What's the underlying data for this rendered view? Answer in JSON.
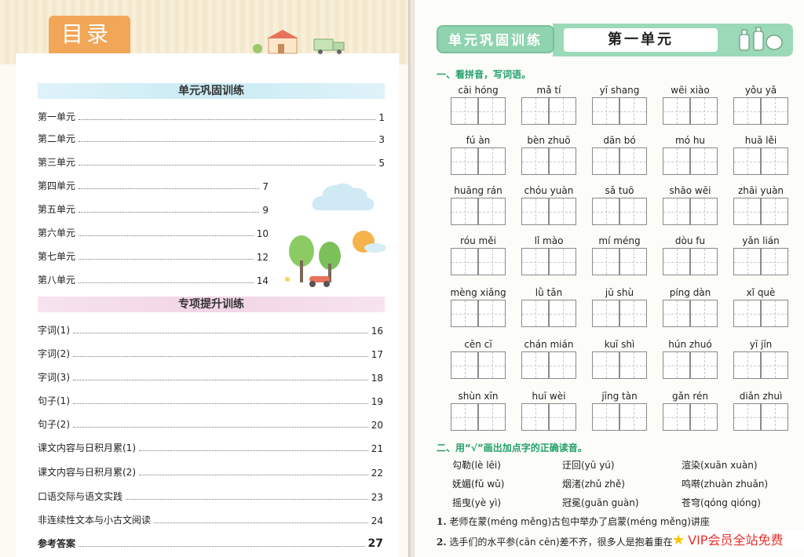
{
  "toc": {
    "tab_title": "目录",
    "section1": {
      "title": "单元巩固训练",
      "items": [
        {
          "label": "第一单元",
          "page": "1"
        },
        {
          "label": "第二单元",
          "page": "3"
        },
        {
          "label": "第三单元",
          "page": "5"
        },
        {
          "label": "第四单元",
          "page": "7"
        },
        {
          "label": "第五单元",
          "page": "9"
        },
        {
          "label": "第六单元",
          "page": "10"
        },
        {
          "label": "第七单元",
          "page": "12"
        },
        {
          "label": "第八单元",
          "page": "14"
        }
      ]
    },
    "section2": {
      "title": "专项提升训练",
      "items": [
        {
          "label": "字词(1)",
          "page": "16"
        },
        {
          "label": "字词(2)",
          "page": "17"
        },
        {
          "label": "字词(3)",
          "page": "18"
        },
        {
          "label": "句子(1)",
          "page": "19"
        },
        {
          "label": "句子(2)",
          "page": "20"
        },
        {
          "label": "课文内容与日积月累(1)",
          "page": "21"
        },
        {
          "label": "课文内容与日积月累(2)",
          "page": "22"
        },
        {
          "label": "口语交际与语文实践",
          "page": "23"
        },
        {
          "label": "非连续性文本与小古文阅读",
          "page": "24"
        }
      ]
    },
    "answers": {
      "label": "参考答案",
      "page": "27"
    }
  },
  "exercise": {
    "header_label": "单元巩固训练",
    "unit_title": "第一单元",
    "q1_title": "一、看拼音，写词语。",
    "pinyin": [
      "cāi hóng",
      "mǎ tí",
      "yī shang",
      "wēi xiào",
      "yǒu yǎ",
      "fú àn",
      "bèn zhuō",
      "dān bó",
      "mó hu",
      "huā lěi",
      "huāng rán",
      "chóu yuàn",
      "sǎ tuō",
      "shāo wēi",
      "zhāi yuàn",
      "róu měi",
      "lǐ mào",
      "mí méng",
      "dòu fu",
      "yǎn lián",
      "mèng xiǎng",
      "lǜ tǎn",
      "jū shù",
      "píng dàn",
      "xǐ què",
      "cēn cī",
      "chán mián",
      "kuī shì",
      "hún zhuó",
      "yī jīn",
      "shùn xīn",
      "huī wèi",
      "jīng tàn",
      "gǎn rén",
      "diǎn zhuì"
    ],
    "q2_title": "二、用“√”画出加点字的正确读音。",
    "choices": [
      "勾勒(lè  lēi)",
      "迂回(yū  yú)",
      "渲染(xuān  xuàn)",
      "妩媚(fǔ  wǔ)",
      "烟渚(zhǔ  zhě)",
      "鸣啭(zhuàn  zhuǎn)",
      "摇曳(yè  yì)",
      "冠冕(guān  guàn)",
      "苍穹(qóng  qióng)"
    ],
    "sentences": [
      {
        "num": "1.",
        "text": "老师在蒙(méng  měng)古包中举办了启蒙(méng  měng)讲座"
      },
      {
        "num": "2.",
        "text": "选手们的水平参(cān  cēn)差不齐，很多人是抱着重在参"
      }
    ]
  },
  "overlay": {
    "vip_text": "VIP会员全站免费"
  },
  "colors": {
    "toc_tab": "#f2a657",
    "exercise_green": "#23a06a",
    "header_green": "#9bd9b8",
    "vip_red": "#e6322d"
  }
}
